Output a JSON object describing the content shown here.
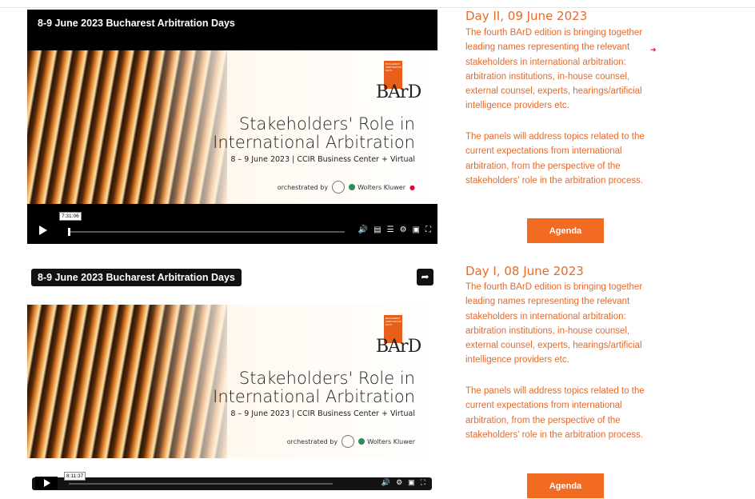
{
  "videos": [
    {
      "title": "8-9 June 2023 Bucharest Arbitration Days",
      "poster": {
        "badge_text": "BUCHAREST ARBITRATION DAYS",
        "brand": "BArD",
        "title_line1": "Stakeholders' Role in",
        "title_line2": "International Arbitration",
        "subtitle": "8 – 9 June 2023 | CCIR Business Center + Virtual",
        "orchestrated": "orchestrated by",
        "partner": "Wolters Kluwer"
      },
      "time_tooltip": "7:31:06",
      "progress": 0.0
    },
    {
      "title": "8-9 June 2023 Bucharest Arbitration Days",
      "poster": {
        "badge_text": "BUCHAREST ARBITRATION DAYS",
        "brand": "BArD",
        "title_line1": "Stakeholders' Role in",
        "title_line2": "International Arbitration",
        "subtitle": "8 – 9 June 2023 | CCIR Business Center + Virtual",
        "orchestrated": "orchestrated by",
        "partner": "Wolters Kluwer"
      },
      "time_tooltip": "8:11:37",
      "progress": 0.0
    }
  ],
  "icons": {
    "share": "share-icon",
    "play": "play-icon",
    "volume": "volume-icon",
    "captions": "captions-icon",
    "chapters": "chapters-icon",
    "settings": "gear-icon",
    "pip": "pip-icon",
    "fullscreen": "fullscreen-icon"
  },
  "days": [
    {
      "heading": "Day II, 09 June 2023",
      "para1": "The fourth BArD edition is bringing together leading names representing the relevant stakeholders in international arbitration: arbitration institutions, in-house counsel, external counsel, experts, hearings/artificial intelligence providers etc.",
      "para2": "The panels will address topics related to the current expectations from international arbitration, from the perspective of the stakeholders' role in the arbitration process.",
      "button": "Agenda"
    },
    {
      "heading": "Day I, 08 June 2023",
      "para1": "The fourth BArD edition is bringing together leading names representing the relevant stakeholders in international arbitration: arbitration institutions, in-house counsel, external counsel, experts, hearings/artificial intelligence providers etc.",
      "para2": "The panels will address topics related to the current expectations from international arbitration, from the perspective of the stakeholders' role in the arbitration process.",
      "button": "Agenda"
    }
  ],
  "colors": {
    "accent": "#f26b23",
    "text_orange": "#e8692a",
    "player_bg": "#000000"
  }
}
